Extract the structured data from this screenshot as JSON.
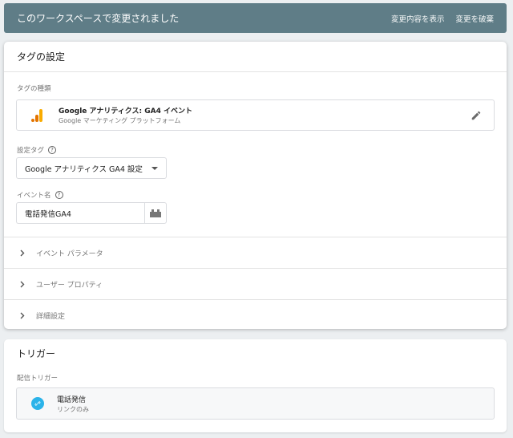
{
  "banner": {
    "title": "このワークスペースで変更されました",
    "show_changes": "変更内容を表示",
    "discard": "変更を破棄"
  },
  "tag_config": {
    "title": "タグの設定",
    "tag_type_label": "タグの種類",
    "tag_type_name": "Google アナリティクス: GA4 イベント",
    "tag_type_platform": "Google マーケティング プラットフォーム",
    "config_tag_label": "設定タグ",
    "config_tag_value": "Google アナリティクス GA4 設定",
    "event_name_label": "イベント名",
    "event_name_value": "電話発信GA4",
    "sections": [
      {
        "label": "イベント パラメータ"
      },
      {
        "label": "ユーザー プロパティ"
      },
      {
        "label": "詳細設定"
      }
    ]
  },
  "trigger": {
    "title": "トリガー",
    "firing_label": "配信トリガー",
    "name": "電話発信",
    "type": "リンクのみ"
  },
  "icons": {
    "help": "?",
    "accent": "#2bb3e9",
    "ga_orange": "#e37400",
    "ga_yellow": "#f9ab00",
    "banner_bg": "#5f7d87"
  }
}
